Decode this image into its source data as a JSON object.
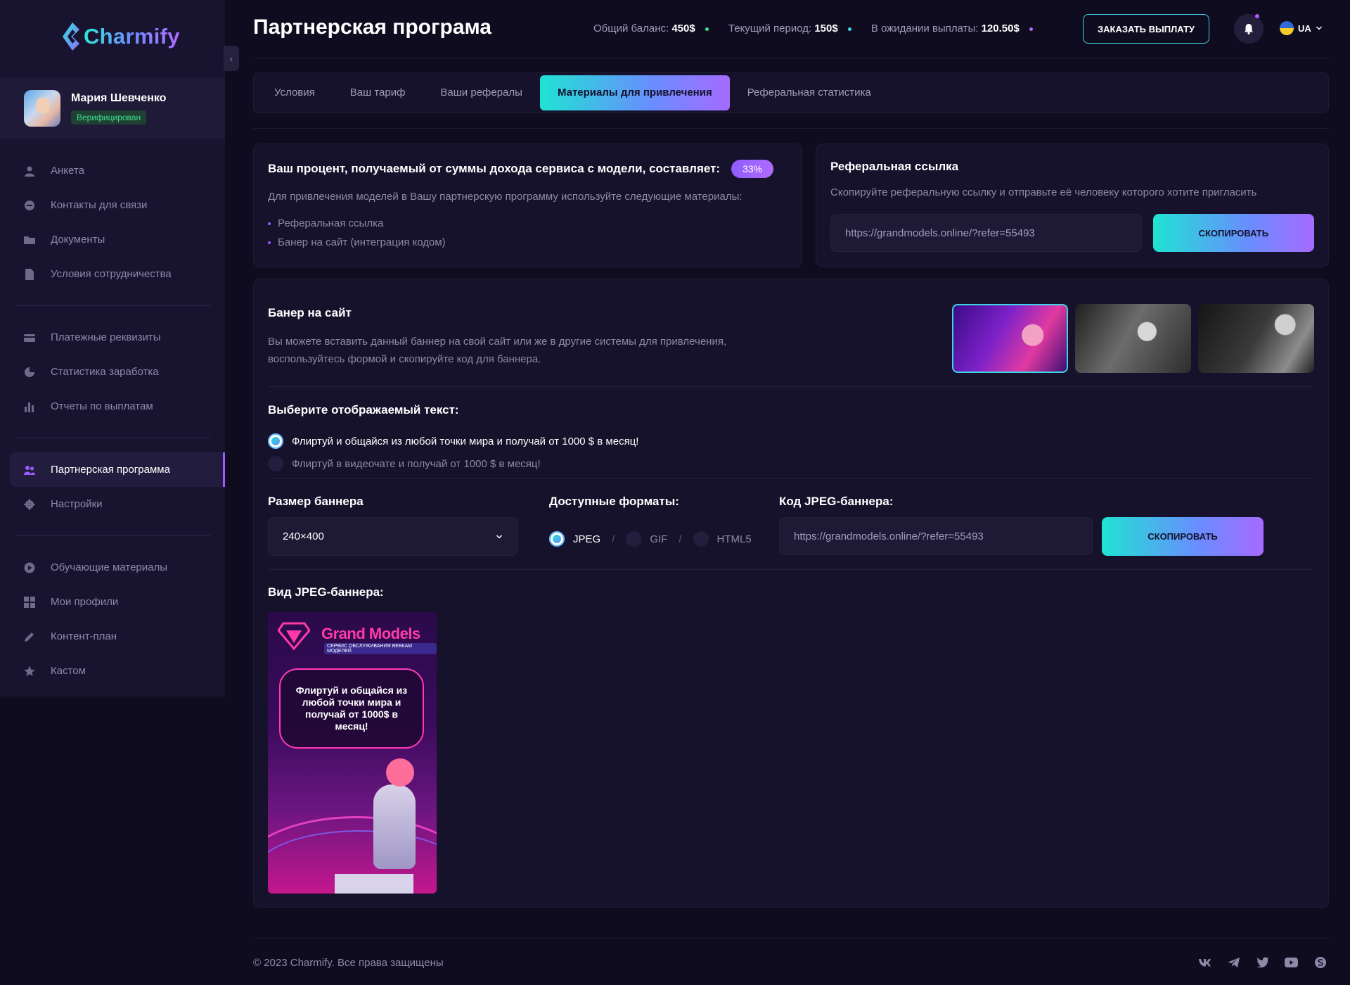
{
  "app": {
    "logo_text": "Charmify",
    "collapse_icon": "chevron-left-icon"
  },
  "user": {
    "name": "Мария Шевченко",
    "status": "Верифицирован"
  },
  "sidebar": {
    "group1": [
      {
        "label": "Анкета",
        "icon": "user-icon"
      },
      {
        "label": "Контакты для связи",
        "icon": "chat-icon"
      },
      {
        "label": "Документы",
        "icon": "folder-icon"
      },
      {
        "label": "Условия сотрудничества",
        "icon": "file-icon"
      }
    ],
    "group2": [
      {
        "label": "Платежные реквизиты",
        "icon": "card-icon"
      },
      {
        "label": "Статистика заработка",
        "icon": "pie-chart-icon"
      },
      {
        "label": "Отчеты по выплатам",
        "icon": "bar-chart-icon"
      }
    ],
    "group3": [
      {
        "label": "Партнерская программа",
        "icon": "users-icon",
        "active": true
      },
      {
        "label": "Настройки",
        "icon": "gear-icon"
      }
    ],
    "group4": [
      {
        "label": "Обучающие материалы",
        "icon": "play-icon"
      },
      {
        "label": "Мои профили",
        "icon": "grid-icon"
      },
      {
        "label": "Контент-план",
        "icon": "pencil-icon"
      },
      {
        "label": "Кастом",
        "icon": "star-icon"
      }
    ]
  },
  "header": {
    "title": "Партнерская програма",
    "balance_label": "Общий баланс:",
    "balance_value": "450$",
    "period_label": "Текущий период:",
    "period_value": "150$",
    "pending_label": "В ожидании выплаты:",
    "pending_value": "120.50$",
    "payout_button": "ЗАКАЗАТЬ ВЫПЛАТУ",
    "language": "UA",
    "colors": {
      "balance_dot": "#3fe08f",
      "period_dot": "#3fd1e4",
      "pending_dot": "#b06bff"
    }
  },
  "tabs": [
    {
      "label": "Условия"
    },
    {
      "label": "Ваш тариф"
    },
    {
      "label": "Ваши рефералы"
    },
    {
      "label": "Материалы для привлечения",
      "active": true
    },
    {
      "label": "Реферальная статистика"
    }
  ],
  "percent_card": {
    "title": "Ваш процент, получаемый от суммы дохода сервиса с модели, составляет:",
    "percent": "33%",
    "description": "Для привлечения моделей в Вашу партнерскую программу используйте следующие материалы:",
    "items": [
      "Реферальная ссылка",
      "Банер на сайт (интеграция кодом)"
    ]
  },
  "referral_card": {
    "title": "Реферальная ссылка",
    "description": "Скопируйте реферальную ссылку и отправьте её человеку которого хотите пригласить",
    "link": "https://grandmodels.online/?refer=55493",
    "copy_button": "СКОПИРОВАТЬ"
  },
  "banner_card": {
    "title": "Банер на сайт",
    "description": "Вы можете вставить данный баннер на свой сайт или же в другие системы для привлечения, воспользуйтесь формой и скопируйте код для баннера.",
    "choose_text_title": "Выберите отображаемый текст:",
    "text_options": [
      {
        "label": "Флиртуй и общайся из любой точки мира и получай от 1000 $ в месяц!",
        "selected": true
      },
      {
        "label": "Флиртуй в видеочате и получай от 1000 $ в месяц!",
        "selected": false
      }
    ],
    "size_title": "Размер баннера",
    "size_value": "240×400",
    "formats_title": "Доступные форматы:",
    "formats": [
      {
        "label": "JPEG",
        "selected": true
      },
      {
        "label": "GIF",
        "selected": false
      },
      {
        "label": "HTML5",
        "selected": false
      }
    ],
    "code_title": "Код JPEG-баннера:",
    "code_value": "https://grandmodels.online/?refer=55493",
    "code_copy_button": "СКОПИРОВАТЬ",
    "preview_title": "Вид JPEG-баннера:",
    "preview": {
      "brand": "Grand Models",
      "subtitle": "СЕРВИС ОБСЛУЖИВАНИЯ ВЕБКАМ МОДЕЛЕЙ",
      "slogan": "Флиртуй и общайся из любой точки мира и получай от 1000$ в месяц!"
    }
  },
  "footer": {
    "copyright": "© 2023 Charmify. Все права защищены",
    "socials": [
      "vk-icon",
      "telegram-icon",
      "twitter-icon",
      "youtube-icon",
      "skype-icon"
    ]
  }
}
